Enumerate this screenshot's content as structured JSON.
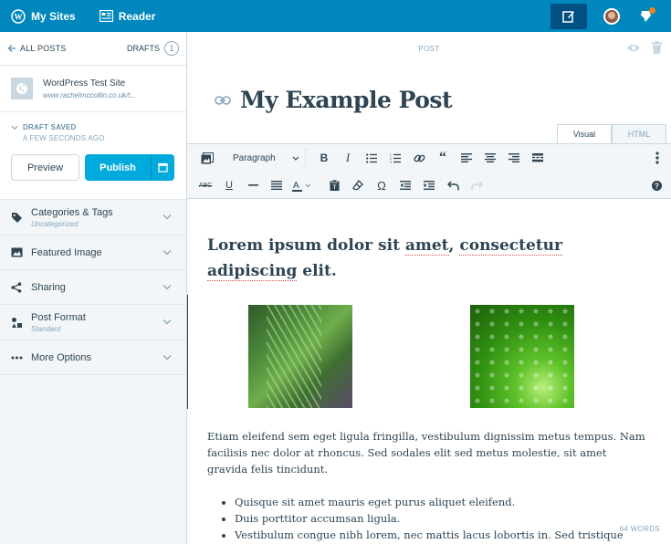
{
  "topbar": {
    "my_sites": "My Sites",
    "reader": "Reader",
    "brand_color": "#0087be",
    "icons": [
      "wordpress-logo-icon",
      "reader-icon",
      "write-icon",
      "avatar",
      "notifications-icon"
    ]
  },
  "sidebar": {
    "back_label": "ALL POSTS",
    "drafts_label": "DRAFTS",
    "drafts_count": "1",
    "site_title": "WordPress Test Site",
    "site_url": "www.rachelmccollin.co.uk/t...",
    "status_label": "DRAFT SAVED",
    "status_time": "A FEW SECONDS AGO",
    "preview_label": "Preview",
    "publish_label": "Publish",
    "items": [
      {
        "label": "Categories & Tags",
        "sub": "Uncategorized",
        "icon": "tag-icon"
      },
      {
        "label": "Featured Image",
        "sub": "",
        "icon": "image-icon"
      },
      {
        "label": "Sharing",
        "sub": "",
        "icon": "share-icon"
      },
      {
        "label": "Post Format",
        "sub": "Standard",
        "icon": "post-format-icon"
      },
      {
        "label": "More Options",
        "sub": "",
        "icon": "ellipsis-icon"
      }
    ]
  },
  "editor": {
    "post_label": "POST",
    "title": "My Example Post",
    "tabs": {
      "visual": "Visual",
      "html": "HTML"
    },
    "format_select": "Paragraph",
    "heading_parts": {
      "a": "Lorem ipsum dolor sit ",
      "b": "amet",
      "c": ", ",
      "d": "consectetur",
      "e": " ",
      "f": "adipiscing",
      "g": " elit."
    },
    "paragraph": "Etiam eleifend sem eget ligula fringilla, vestibulum dignissim metus tempus. Nam facilisis nec dolor at rhoncus. Sed sodales elit sed metus molestie, sit amet gravida felis tincidunt.",
    "list": [
      "Quisque sit amet mauris eget purus aliquet eleifend.",
      "Duis porttitor accumsan ligula.",
      "Vestibulum congue nibh lorem, nec mattis lacus lobortis in. Sed tristique"
    ],
    "word_count": "64 WORDS"
  }
}
